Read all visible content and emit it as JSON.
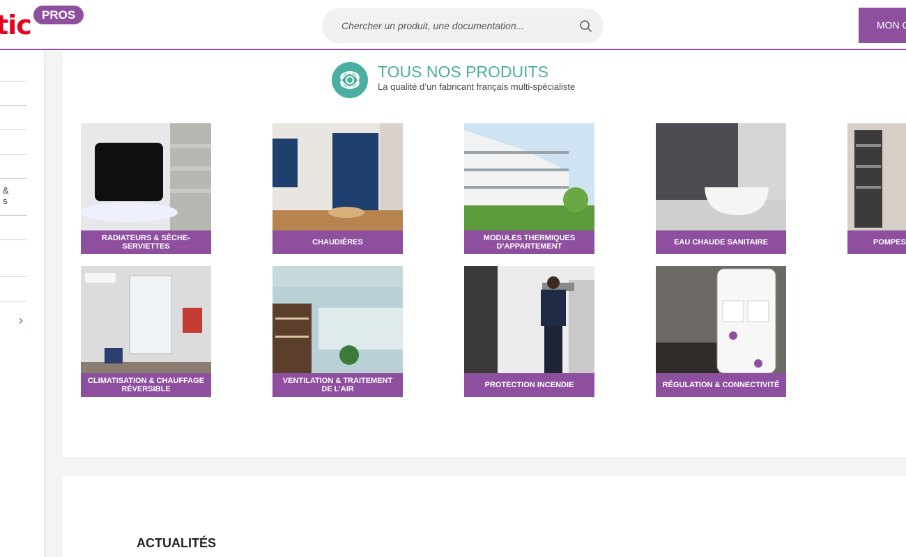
{
  "header": {
    "logo_text": "tic",
    "pros_badge": "PROS",
    "search_placeholder": "Chercher un produit, une documentation...",
    "account_button": "MON C"
  },
  "sidebar": {
    "fragments": [
      "&",
      "s"
    ],
    "chevron": "›"
  },
  "section": {
    "title": "TOUS NOS PRODUITS",
    "subtitle": "La qualité d’un fabricant français multi-spécialiste"
  },
  "products": [
    {
      "label": "RADIATEURS & SÈCHE-SERVIETTES"
    },
    {
      "label": "CHAUDIÈRES"
    },
    {
      "label": "MODULES THERMIQUES D’APPARTEMENT"
    },
    {
      "label": "EAU CHAUDE SANITAIRE"
    },
    {
      "label": "POMPES"
    },
    {
      "label": "CLIMATISATION & CHAUFFAGE RÉVERSIBLE"
    },
    {
      "label": "VENTILATION & TRAITEMENT DE L’AIR"
    },
    {
      "label": "PROTECTION INCENDIE"
    },
    {
      "label": "RÉGULATION & CONNECTIVITÉ"
    }
  ],
  "news": {
    "title": "ACTUALITÉS"
  },
  "colors": {
    "brand_purple": "#8e4f9f",
    "brand_teal": "#4aaea1",
    "logo_red": "#e2001a"
  }
}
